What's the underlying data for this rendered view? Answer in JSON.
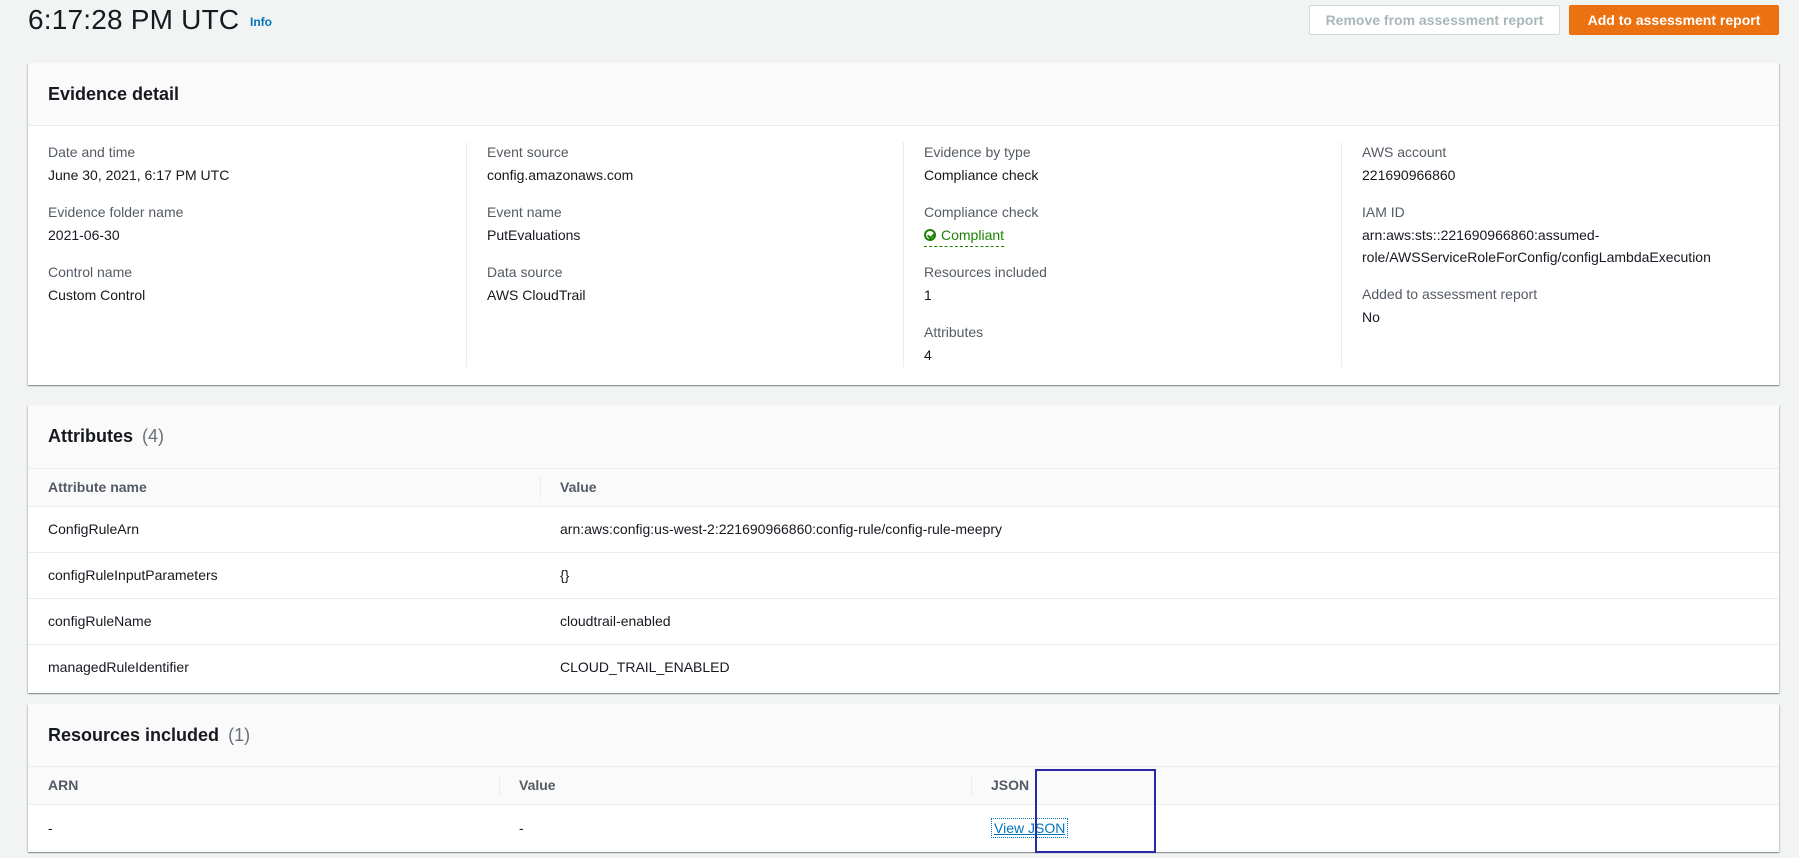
{
  "header": {
    "title": "6:17:28 PM UTC",
    "info_link": "Info",
    "remove_button": "Remove from assessment report",
    "add_button": "Add to assessment report"
  },
  "evidence_detail": {
    "title": "Evidence detail",
    "col1": [
      {
        "label": "Date and time",
        "value": "June 30, 2021, 6:17 PM UTC"
      },
      {
        "label": "Evidence folder name",
        "value": "2021-06-30"
      },
      {
        "label": "Control name",
        "value": "Custom Control"
      }
    ],
    "col2": [
      {
        "label": "Event source",
        "value": "config.amazonaws.com"
      },
      {
        "label": "Event name",
        "value": "PutEvaluations"
      },
      {
        "label": "Data source",
        "value": "AWS CloudTrail"
      }
    ],
    "col3": [
      {
        "label": "Evidence by type",
        "value": "Compliance check"
      },
      {
        "label": "Compliance check",
        "value": "Compliant"
      },
      {
        "label": "Resources included",
        "value": "1"
      },
      {
        "label": "Attributes",
        "value": "4"
      }
    ],
    "col4": [
      {
        "label": "AWS account",
        "value": "221690966860"
      },
      {
        "label": "IAM ID",
        "value_line1": "arn:aws:sts::221690966860:assumed-",
        "value_line2": "role/AWSServiceRoleForConfig/configLambdaExecution"
      },
      {
        "label": "Added to assessment report",
        "value": "No"
      }
    ]
  },
  "attributes": {
    "title": "Attributes",
    "count": "(4)",
    "columns": [
      "Attribute name",
      "Value"
    ],
    "rows": [
      {
        "name": "ConfigRuleArn",
        "value": "arn:aws:config:us-west-2:221690966860:config-rule/config-rule-meepry"
      },
      {
        "name": "configRuleInputParameters",
        "value": "{}"
      },
      {
        "name": "configRuleName",
        "value": "cloudtrail-enabled"
      },
      {
        "name": "managedRuleIdentifier",
        "value": "CLOUD_TRAIL_ENABLED"
      }
    ]
  },
  "resources": {
    "title": "Resources included",
    "count": "(1)",
    "columns": [
      "ARN",
      "Value",
      "JSON"
    ],
    "rows": [
      {
        "arn": "-",
        "value": "-",
        "json": "View JSON"
      }
    ]
  },
  "colors": {
    "accent": "#ec7211",
    "link": "#0073bb",
    "success": "#1d8102",
    "highlight": "#2929a8"
  },
  "icons": {
    "compliant": "check-circle-icon"
  }
}
